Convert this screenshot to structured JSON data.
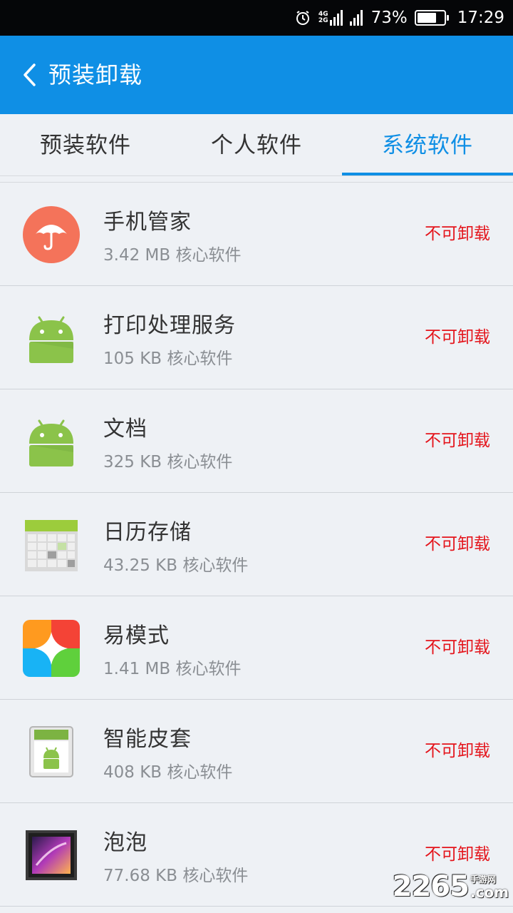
{
  "status_bar": {
    "network_top": "4G",
    "network_bottom": "2G",
    "battery": "73%",
    "battery_level": 0.73,
    "time": "17:29"
  },
  "app_bar": {
    "title": "预装卸载",
    "color": "#0f8fe5"
  },
  "tabs": [
    {
      "label": "预装软件",
      "active": false
    },
    {
      "label": "个人软件",
      "active": false
    },
    {
      "label": "系统软件",
      "active": true
    }
  ],
  "apps": [
    {
      "name": "手机管家",
      "meta": "3.42 MB 核心软件",
      "status": "不可卸载",
      "icon": "phone-manager-icon"
    },
    {
      "name": "打印处理服务",
      "meta": "105 KB 核心软件",
      "status": "不可卸载",
      "icon": "android-icon"
    },
    {
      "name": "文档",
      "meta": "325 KB 核心软件",
      "status": "不可卸载",
      "icon": "android-icon"
    },
    {
      "name": "日历存储",
      "meta": "43.25 KB 核心软件",
      "status": "不可卸载",
      "icon": "calendar-storage-icon"
    },
    {
      "name": "易模式",
      "meta": "1.41 MB 核心软件",
      "status": "不可卸载",
      "icon": "easy-mode-icon"
    },
    {
      "name": "智能皮套",
      "meta": "408 KB 核心软件",
      "status": "不可卸载",
      "icon": "smart-cover-icon"
    },
    {
      "name": "泡泡",
      "meta": "77.68 KB 核心软件",
      "status": "不可卸载",
      "icon": "bubbles-icon"
    }
  ],
  "watermark": {
    "brand": "2265",
    "site_small": "手游网",
    "site_suffix": ".com"
  }
}
